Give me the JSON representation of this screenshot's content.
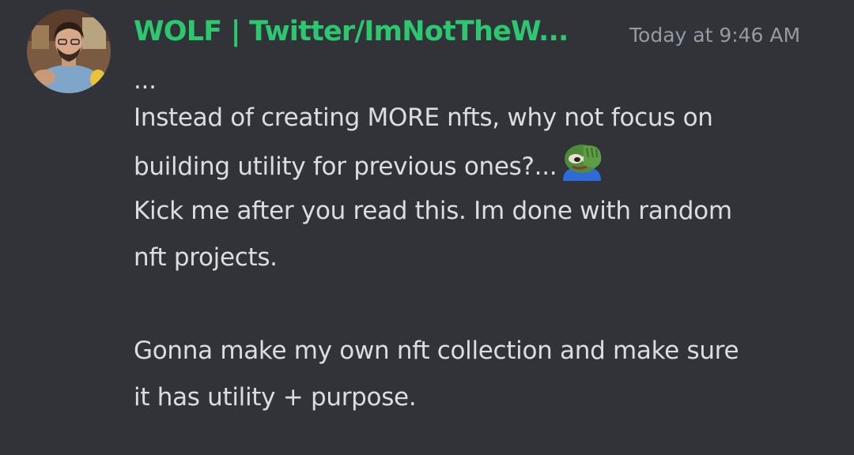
{
  "message": {
    "username": "WOLF | Twitter/ImNotTheW...",
    "timestamp": "Today at 9:46 AM",
    "username_color": "#2dc770",
    "lines": [
      "...",
      "Instead of creating MORE nfts, why not focus on",
      "building utility for previous ones?...",
      "Kick me after you read this. Im done with random",
      "nft projects.",
      "",
      "Gonna make my own nft collection and make sure",
      "it has utility + purpose."
    ],
    "emoji": "facepalm-pepe-emoji"
  },
  "colors": {
    "background": "#313338",
    "text": "#dbdee1",
    "muted": "#949ba4"
  }
}
